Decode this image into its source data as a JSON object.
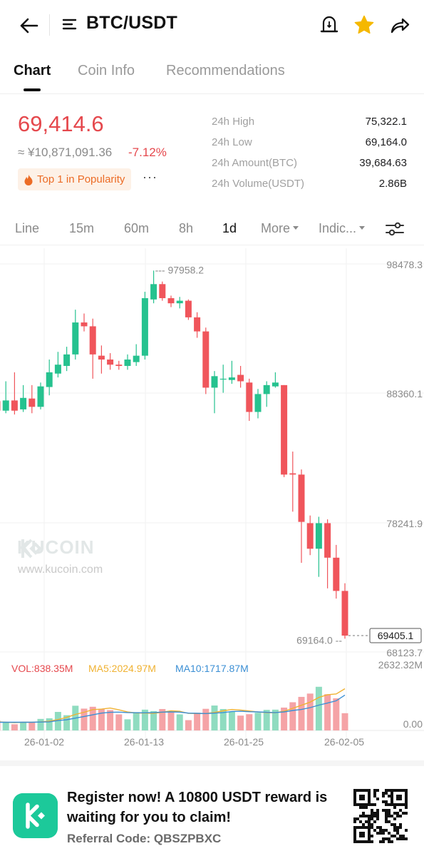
{
  "header": {
    "pair": "BTC/USDT",
    "icons": [
      "back-arrow-icon",
      "menu-icon",
      "price-alert-icon",
      "star-icon",
      "share-icon"
    ],
    "star_color": "#f5b800"
  },
  "tabs": [
    {
      "label": "Chart",
      "active": true
    },
    {
      "label": "Coin Info",
      "active": false
    },
    {
      "label": "Recommendations",
      "active": false
    }
  ],
  "ticker": {
    "last_price": "69,414.6",
    "fiat_value": "≈ ¥10,871,091.36",
    "change_pct": "-7.12%",
    "popularity_badge": "Top 1 in Popularity",
    "more": "···",
    "down_color": "#e5484d",
    "stats": [
      {
        "label": "24h High",
        "value": "75,322.1"
      },
      {
        "label": "24h Low",
        "value": "69,164.0"
      },
      {
        "label": "24h Amount(BTC)",
        "value": "39,684.63"
      },
      {
        "label": "24h Volume(USDT)",
        "value": "2.86B"
      }
    ]
  },
  "intervals": [
    {
      "label": "Line",
      "active": false
    },
    {
      "label": "15m",
      "active": false
    },
    {
      "label": "60m",
      "active": false
    },
    {
      "label": "8h",
      "active": false
    },
    {
      "label": "1d",
      "active": true
    },
    {
      "label": "More",
      "active": false
    },
    {
      "label": "Indic...",
      "active": false
    }
  ],
  "watermark": {
    "brand": "KUCOIN",
    "url": "www.kucoin.com"
  },
  "chart_data": {
    "type": "candlestick",
    "interval": "1d",
    "up_color": "#26c28f",
    "down_color": "#f0555b",
    "price_axis_labels": [
      "98478.3",
      "88360.1",
      "78241.9",
      "68123.7"
    ],
    "price_ylim": [
      68123.7,
      98478.3
    ],
    "max_marker": "97958.2",
    "min_marker": "69164.0",
    "last_price_marker": "69405.1",
    "x_tick_labels": [
      "26-01-02",
      "26-01-13",
      "26-01-25",
      "26-02-05"
    ],
    "candles": [
      {
        "o": 87750,
        "h": 88900,
        "l": 86600,
        "c": 87000
      },
      {
        "o": 87000,
        "h": 89300,
        "l": 86800,
        "c": 87800
      },
      {
        "o": 87800,
        "h": 90000,
        "l": 86700,
        "c": 87000
      },
      {
        "o": 87100,
        "h": 89000,
        "l": 86900,
        "c": 88000
      },
      {
        "o": 87950,
        "h": 89000,
        "l": 86800,
        "c": 87300
      },
      {
        "o": 87300,
        "h": 89200,
        "l": 87100,
        "c": 88900
      },
      {
        "o": 88850,
        "h": 91000,
        "l": 88200,
        "c": 90000
      },
      {
        "o": 89900,
        "h": 91600,
        "l": 89600,
        "c": 90600
      },
      {
        "o": 90500,
        "h": 92000,
        "l": 90100,
        "c": 91400
      },
      {
        "o": 91400,
        "h": 94900,
        "l": 91000,
        "c": 93900
      },
      {
        "o": 93900,
        "h": 94600,
        "l": 93200,
        "c": 93600
      },
      {
        "o": 93600,
        "h": 94200,
        "l": 89500,
        "c": 91400
      },
      {
        "o": 91300,
        "h": 92100,
        "l": 89900,
        "c": 91000
      },
      {
        "o": 91000,
        "h": 91500,
        "l": 90200,
        "c": 90600
      },
      {
        "o": 90600,
        "h": 90900,
        "l": 90200,
        "c": 90500
      },
      {
        "o": 90500,
        "h": 91400,
        "l": 90200,
        "c": 91000
      },
      {
        "o": 90800,
        "h": 92200,
        "l": 90500,
        "c": 91300
      },
      {
        "o": 91300,
        "h": 96300,
        "l": 91000,
        "c": 95800
      },
      {
        "o": 95700,
        "h": 97958,
        "l": 95400,
        "c": 96900
      },
      {
        "o": 96900,
        "h": 97100,
        "l": 95600,
        "c": 95800
      },
      {
        "o": 95800,
        "h": 96000,
        "l": 95100,
        "c": 95400
      },
      {
        "o": 95400,
        "h": 95900,
        "l": 95000,
        "c": 95600
      },
      {
        "o": 95600,
        "h": 95700,
        "l": 94100,
        "c": 94300
      },
      {
        "o": 94300,
        "h": 94700,
        "l": 92700,
        "c": 93200
      },
      {
        "o": 93200,
        "h": 93500,
        "l": 88300,
        "c": 88800
      },
      {
        "o": 88800,
        "h": 90100,
        "l": 86800,
        "c": 89700
      },
      {
        "o": 89500,
        "h": 90600,
        "l": 88400,
        "c": 89500
      },
      {
        "o": 89400,
        "h": 90900,
        "l": 89100,
        "c": 89600
      },
      {
        "o": 89800,
        "h": 90500,
        "l": 88800,
        "c": 89300
      },
      {
        "o": 89200,
        "h": 89500,
        "l": 86200,
        "c": 86900
      },
      {
        "o": 86900,
        "h": 88700,
        "l": 86400,
        "c": 88300
      },
      {
        "o": 88300,
        "h": 89300,
        "l": 87300,
        "c": 89000
      },
      {
        "o": 88900,
        "h": 90000,
        "l": 88800,
        "c": 89200
      },
      {
        "o": 89000,
        "h": 89000,
        "l": 81800,
        "c": 82000
      },
      {
        "o": 82100,
        "h": 83800,
        "l": 79100,
        "c": 82000
      },
      {
        "o": 82000,
        "h": 82400,
        "l": 75100,
        "c": 78300
      },
      {
        "o": 78200,
        "h": 78800,
        "l": 75700,
        "c": 76200
      },
      {
        "o": 76200,
        "h": 78700,
        "l": 74000,
        "c": 78200
      },
      {
        "o": 78200,
        "h": 78500,
        "l": 73100,
        "c": 75500
      },
      {
        "o": 75500,
        "h": 76500,
        "l": 72300,
        "c": 72900
      },
      {
        "o": 72900,
        "h": 73500,
        "l": 69164,
        "c": 69405
      }
    ],
    "volume": {
      "title": "VOL:838.35M",
      "ma5": "MA5:2024.97M",
      "ma10": "MA10:1717.87M",
      "axis_top": "2632.32M",
      "axis_bottom": "0.00",
      "ma5_color": "#f0b232",
      "ma10_color": "#3b8fd4",
      "vol_label_color": "#e5484d",
      "values_M": [
        480,
        410,
        300,
        420,
        380,
        560,
        590,
        900,
        740,
        1200,
        1060,
        1150,
        1030,
        990,
        780,
        540,
        890,
        1010,
        940,
        1040,
        880,
        780,
        500,
        860,
        1050,
        1210,
        1040,
        920,
        720,
        790,
        860,
        1000,
        1010,
        1110,
        1370,
        1630,
        1790,
        2120,
        1760,
        1560,
        838
      ],
      "ma5_M": [
        420,
        400,
        380,
        400,
        400,
        412,
        452,
        530,
        634,
        778,
        882,
        1010,
        1036,
        1087,
        1002,
        898,
        850,
        842,
        832,
        884,
        954,
        930,
        828,
        820,
        822,
        878,
        952,
        1018,
        990,
        944,
        898,
        866,
        860,
        936,
        1072,
        1222,
        1376,
        1604,
        1734,
        1772,
        2025
      ],
      "ma10_M": [
        400,
        400,
        400,
        400,
        400,
        410,
        420,
        480,
        520,
        600,
        680,
        760,
        840,
        880,
        890,
        870,
        860,
        860,
        870,
        890,
        900,
        890,
        840,
        830,
        820,
        840,
        870,
        920,
        930,
        910,
        900,
        880,
        870,
        900,
        970,
        1020,
        1110,
        1230,
        1330,
        1440,
        1718
      ]
    }
  },
  "footer": {
    "promo": "Register now! A 10800 USDT reward is waiting for you to claim!",
    "referral": "Referral Code: QBSZPBXC",
    "brand_color": "#1cc99a"
  }
}
